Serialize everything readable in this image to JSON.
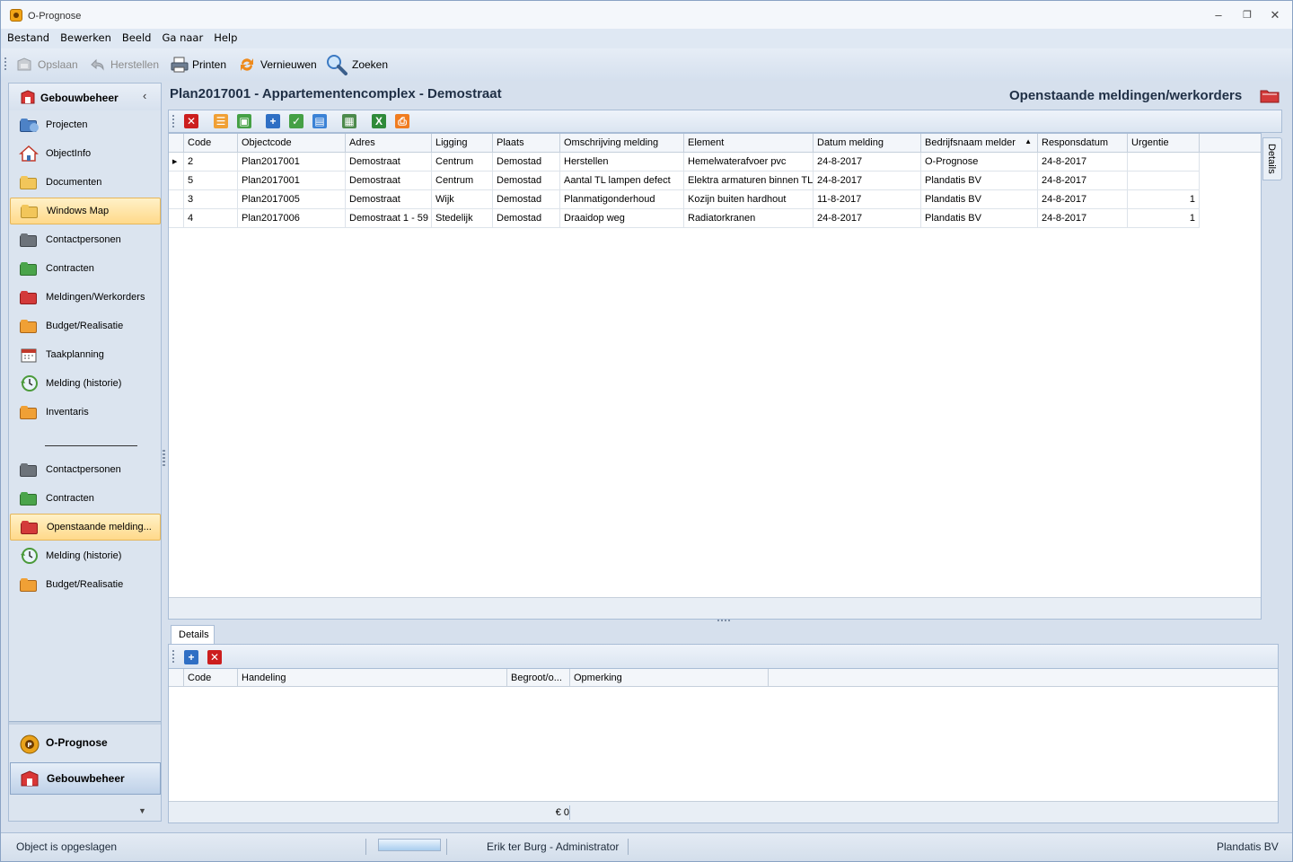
{
  "window": {
    "title": "O-Prognose"
  },
  "menu": [
    "Bestand",
    "Bewerken",
    "Beeld",
    "Ga naar",
    "Help"
  ],
  "toolbar": {
    "save": "Opslaan",
    "restore": "Herstellen",
    "print": "Printen",
    "refresh": "Vernieuwen",
    "search": "Zoeken"
  },
  "sidebar": {
    "title": "Gebouwbeheer",
    "items": [
      {
        "label": "Projecten",
        "icon": "projects-icon"
      },
      {
        "label": "ObjectInfo",
        "icon": "house-icon"
      },
      {
        "label": "Documenten",
        "icon": "folder-documents-icon"
      },
      {
        "label": "Windows Map",
        "icon": "folder-icon",
        "selected": true
      },
      {
        "label": "Contactpersonen",
        "icon": "folder-contacts-icon"
      },
      {
        "label": "Contracten",
        "icon": "folder-contracts-icon"
      },
      {
        "label": "Meldingen/Werkorders",
        "icon": "folder-workorders-icon"
      },
      {
        "label": "Budget/Realisatie",
        "icon": "folder-budget-icon"
      },
      {
        "label": "Taakplanning",
        "icon": "calendar-icon"
      },
      {
        "label": "Melding (historie)",
        "icon": "history-icon"
      },
      {
        "label": "Inventaris",
        "icon": "folder-inventory-icon"
      }
    ],
    "items2": [
      {
        "label": "Contactpersonen",
        "icon": "folder-contacts-icon"
      },
      {
        "label": "Contracten",
        "icon": "folder-contracts-icon"
      },
      {
        "label": "Openstaande melding...",
        "icon": "folder-open-workorders-icon",
        "selected": true
      },
      {
        "label": "Melding (historie)",
        "icon": "history-icon"
      },
      {
        "label": "Budget/Realisatie",
        "icon": "folder-budget-icon"
      }
    ],
    "modules": [
      {
        "label": "O-Prognose",
        "selected": false
      },
      {
        "label": "Gebouwbeheer",
        "selected": true
      }
    ]
  },
  "page": {
    "title": "Plan2017001 - Appartementencomplex - Demostraat",
    "subtitle": "Openstaande meldingen/werkorders",
    "details_tab": "Details"
  },
  "grid": {
    "columns": [
      "Code",
      "Objectcode",
      "Adres",
      "Ligging",
      "Plaats",
      "Omschrijving melding",
      "Element",
      "Datum melding",
      "Bedrijfsnaam melder",
      "Responsdatum",
      "Urgentie"
    ],
    "sorted_column": "Bedrijfsnaam melder",
    "rows": [
      [
        "2",
        "Plan2017001",
        "Demostraat",
        "Centrum",
        "Demostad",
        "Herstellen",
        "Hemelwaterafvoer pvc",
        "24-8-2017",
        "O-Prognose",
        "24-8-2017",
        ""
      ],
      [
        "5",
        "Plan2017001",
        "Demostraat",
        "Centrum",
        "Demostad",
        "Aantal TL lampen defect",
        "Elektra armaturen binnen TL",
        "24-8-2017",
        "Plandatis BV",
        "24-8-2017",
        ""
      ],
      [
        "3",
        "Plan2017005",
        "Demostraat",
        "Wijk",
        "Demostad",
        "Planmatigonderhoud",
        "Kozijn buiten hardhout",
        "11-8-2017",
        "Plandatis BV",
        "24-8-2017",
        "1"
      ],
      [
        "4",
        "Plan2017006",
        "Demostraat 1 - 59",
        "Stedelijk",
        "Demostad",
        "Draaidop weg",
        "Radiatorkranen",
        "24-8-2017",
        "Plandatis BV",
        "24-8-2017",
        "1"
      ]
    ]
  },
  "details": {
    "tab": "Details",
    "columns": [
      "Code",
      "Handeling",
      "Begroot/o...",
      "Opmerking"
    ],
    "total": "€ 0"
  },
  "status": {
    "message": "Object is opgeslagen",
    "user": "Erik ter Burg - Administrator",
    "company": "Plandatis BV",
    "progress": 1.0
  }
}
